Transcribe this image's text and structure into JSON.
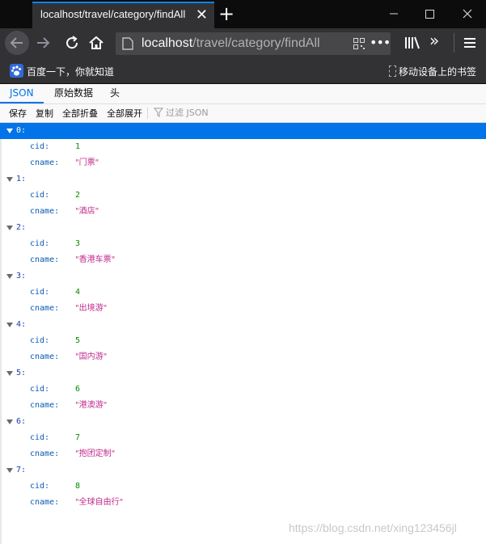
{
  "browser": {
    "tab_title": "localhost/travel/category/findAll",
    "tab_close": "✕",
    "new_tab": "+",
    "url_host": "localhost",
    "url_path": "/travel/category/findAll",
    "url_more": "•••",
    "overflow": "»"
  },
  "bookmarks": {
    "baidu_label": "百度一下，你就知道",
    "mobile_label": "移动设备上的书签"
  },
  "viewer": {
    "tabs": [
      "JSON",
      "原始数据",
      "头"
    ],
    "selected_tab": "JSON",
    "toolbar": {
      "save": "保存",
      "copy": "复制",
      "collapse_all": "全部折叠",
      "expand_all": "全部展开",
      "filter_placeholder": "过滤 JSON"
    }
  },
  "json_items": [
    {
      "index": "0:",
      "cid_key": "cid:",
      "cid": "1",
      "cname_key": "cname:",
      "cname": "\"门票\""
    },
    {
      "index": "1:",
      "cid_key": "cid:",
      "cid": "2",
      "cname_key": "cname:",
      "cname": "\"酒店\""
    },
    {
      "index": "2:",
      "cid_key": "cid:",
      "cid": "3",
      "cname_key": "cname:",
      "cname": "\"香港车票\""
    },
    {
      "index": "3:",
      "cid_key": "cid:",
      "cid": "4",
      "cname_key": "cname:",
      "cname": "\"出境游\""
    },
    {
      "index": "4:",
      "cid_key": "cid:",
      "cid": "5",
      "cname_key": "cname:",
      "cname": "\"国内游\""
    },
    {
      "index": "5:",
      "cid_key": "cid:",
      "cid": "6",
      "cname_key": "cname:",
      "cname": "\"港澳游\""
    },
    {
      "index": "6:",
      "cid_key": "cid:",
      "cid": "7",
      "cname_key": "cname:",
      "cname": "\"抱团定制\""
    },
    {
      "index": "7:",
      "cid_key": "cid:",
      "cid": "8",
      "cname_key": "cname:",
      "cname": "\"全球自由行\""
    }
  ],
  "selected_index": "0:",
  "watermark": "https://blog.csdn.net/xing123456jl",
  "colors": {
    "accent": "#0074e8",
    "chrome_dark": "#323234",
    "key": "#0b59b4",
    "number": "#058b00",
    "string": "#c22a8d"
  }
}
